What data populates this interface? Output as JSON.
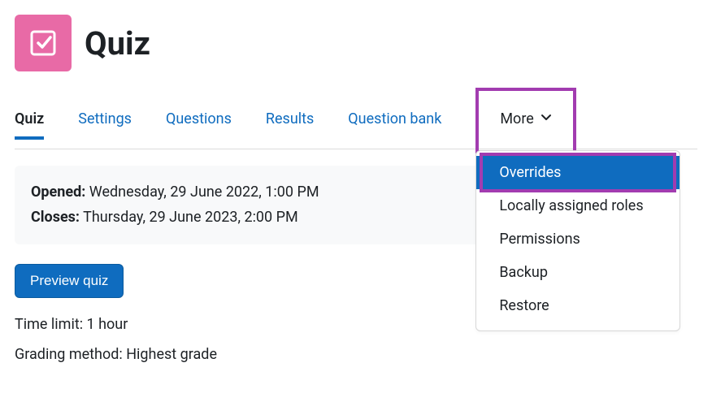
{
  "header": {
    "title": "Quiz"
  },
  "tabs": {
    "items": [
      {
        "label": "Quiz",
        "active": true
      },
      {
        "label": "Settings",
        "active": false
      },
      {
        "label": "Questions",
        "active": false
      },
      {
        "label": "Results",
        "active": false
      },
      {
        "label": "Question bank",
        "active": false
      }
    ],
    "more_label": "More"
  },
  "more_menu": {
    "items": [
      {
        "label": "Overrides",
        "selected": true
      },
      {
        "label": "Locally assigned roles",
        "selected": false
      },
      {
        "label": "Permissions",
        "selected": false
      },
      {
        "label": "Backup",
        "selected": false
      },
      {
        "label": "Restore",
        "selected": false
      }
    ]
  },
  "info": {
    "opened_label": "Opened:",
    "opened_value": "Wednesday, 29 June 2022, 1:00 PM",
    "closes_label": "Closes:",
    "closes_value": "Thursday, 29 June 2023, 2:00 PM"
  },
  "buttons": {
    "preview": "Preview quiz"
  },
  "meta": {
    "time_limit": "Time limit: 1 hour",
    "grading_method": "Grading method: Highest grade"
  },
  "colors": {
    "accent": "#0f6cbf",
    "quiz_icon_bg": "#e86aa6",
    "highlight": "#a23cb0"
  }
}
